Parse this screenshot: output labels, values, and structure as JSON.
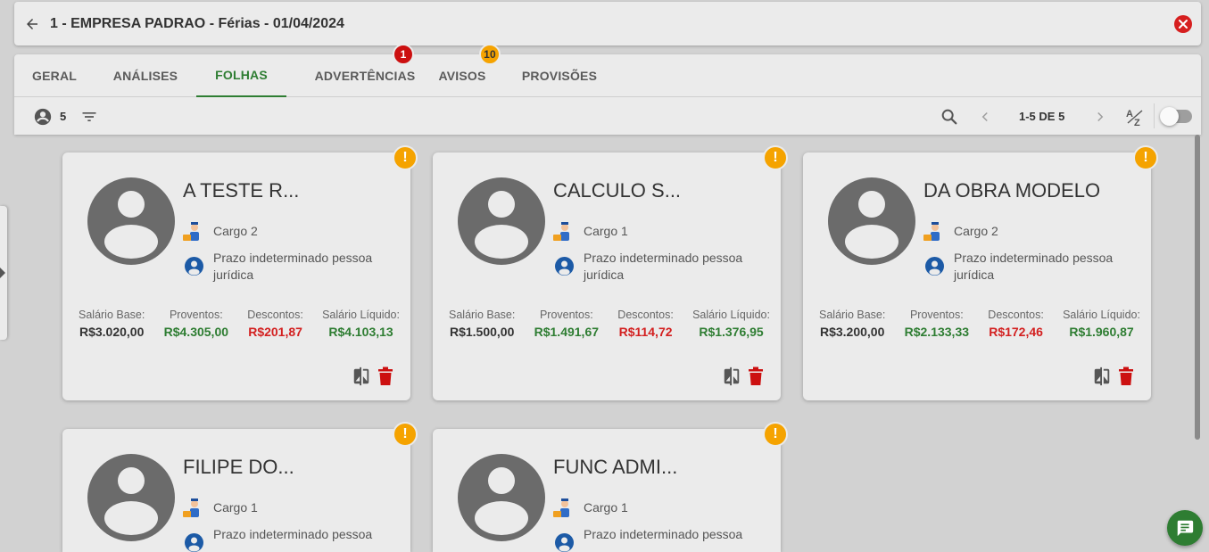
{
  "header": {
    "title": "1 - EMPRESA PADRAO - Férias - 01/04/2024",
    "back_icon": "arrow-left-icon",
    "close_icon": "close-circle-icon",
    "close_color": "#d61f1f"
  },
  "tabs": [
    {
      "label": "GERAL"
    },
    {
      "label": "ANÁLISES"
    },
    {
      "label": "FOLHAS",
      "active": true
    },
    {
      "label": "ADVERTÊNCIAS",
      "badge": "1",
      "badge_color": "#cc1010"
    },
    {
      "label": "AVISOS",
      "badge": "10",
      "badge_color": "#f5a300"
    },
    {
      "label": "PROVISÕES"
    }
  ],
  "toolbar": {
    "employee_count": "5",
    "pagination": "1-5 DE 5"
  },
  "labels": {
    "base": "Salário Base:",
    "proventos": "Proventos:",
    "descontos": "Descontos:",
    "liquido": "Salário Líquido:"
  },
  "employees": [
    {
      "name": "A TESTE R...",
      "job": "Cargo 2",
      "contract": "Prazo indeterminado pessoa jurídica",
      "base": "R$3.020,00",
      "proventos": "R$4.305,00",
      "descontos": "R$201,87",
      "liquido": "R$4.103,13",
      "warning": "!"
    },
    {
      "name": "CALCULO S...",
      "job": "Cargo 1",
      "contract": "Prazo indeterminado pessoa jurídica",
      "base": "R$1.500,00",
      "proventos": "R$1.491,67",
      "descontos": "R$114,72",
      "liquido": "R$1.376,95",
      "warning": "!"
    },
    {
      "name": "DA OBRA MODELO",
      "job": "Cargo 2",
      "contract": "Prazo indeterminado pessoa jurídica",
      "base": "R$3.200,00",
      "proventos": "R$2.133,33",
      "descontos": "R$172,46",
      "liquido": "R$1.960,87",
      "warning": "!"
    },
    {
      "name": "FILIPE DO...",
      "job": "Cargo 1",
      "contract": "Prazo indeterminado pessoa jurídica",
      "warning": "!"
    },
    {
      "name": "FUNC ADMI...",
      "job": "Cargo 1",
      "contract": "Prazo indeterminado pessoa jurídica",
      "warning": "!"
    }
  ],
  "colors": {
    "accent": "#2e7d32",
    "positive": "#2e7d32",
    "negative": "#d32020",
    "warning": "#f5a300"
  }
}
